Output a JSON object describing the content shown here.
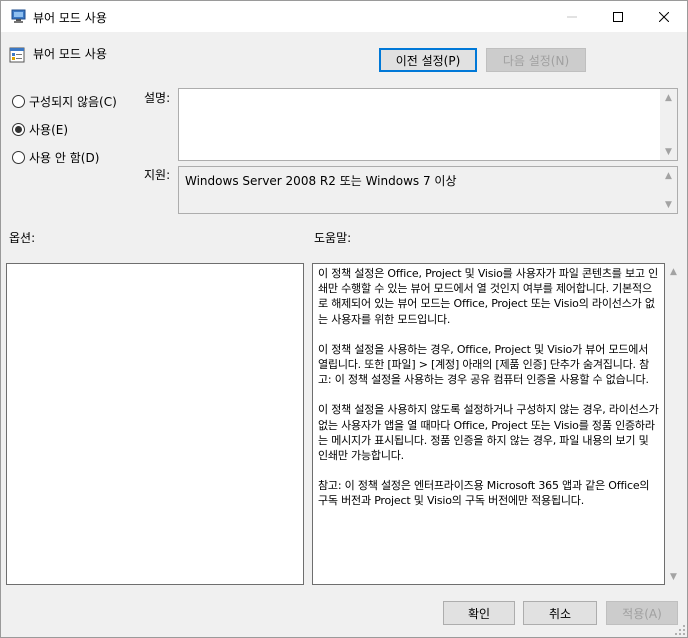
{
  "window": {
    "title": "뷰어 모드 사용",
    "icon": "policy-window-icon",
    "controls": {
      "minimize_icon": "minimize-icon",
      "maximize_icon": "maximize-icon",
      "close_icon": "close-icon"
    }
  },
  "header": {
    "title": "뷰어 모드 사용",
    "icon": "policy-setting-icon",
    "prev_label": "이전 설정(P)",
    "next_label": "다음 설정(N)"
  },
  "state": {
    "options": [
      {
        "label": "구성되지 않음(C)",
        "selected": false
      },
      {
        "label": "사용(E)",
        "selected": true
      },
      {
        "label": "사용 안 함(D)",
        "selected": false
      }
    ]
  },
  "description": {
    "label": "설명:",
    "value": ""
  },
  "supported": {
    "label": "지원:",
    "value": "Windows Server 2008 R2 또는 Windows 7 이상"
  },
  "options_panel": {
    "label": "옵션:"
  },
  "help_panel": {
    "label": "도움말:",
    "paragraphs": [
      "이 정책 설정은 Office, Project 및 Visio를 사용자가 파일 콘텐츠를 보고 인쇄만 수행할 수 있는 뷰어 모드에서 열 것인지 여부를 제어합니다. 기본적으로 해제되어 있는 뷰어 모드는 Office, Project 또는 Visio의 라이선스가 없는 사용자를 위한 모드입니다.",
      "이 정책 설정을 사용하는 경우, Office, Project 및 Visio가 뷰어 모드에서 열립니다. 또한 [파일] > [계정] 아래의 [제품 인증] 단추가 숨겨집니다. 참고: 이 정책 설정을 사용하는 경우 공유 컴퓨터 인증을 사용할 수 없습니다.",
      "이 정책 설정을 사용하지 않도록 설정하거나 구성하지 않는 경우, 라이선스가 없는 사용자가 앱을 열 때마다 Office, Project 또는 Visio를 정품 인증하라는 메시지가 표시됩니다. 정품 인증을 하지 않는 경우, 파일 내용의 보기 및 인쇄만 가능합니다.",
      "참고: 이 정책 설정은 엔터프라이즈용 Microsoft 365 앱과 같은 Office의 구독 버전과 Project 및 Visio의 구독 버전에만 적용됩니다."
    ]
  },
  "footer": {
    "ok_label": "확인",
    "cancel_label": "취소",
    "apply_label": "적용(A)"
  },
  "colors": {
    "default_button_border": "#0078d7",
    "window_bg": "#f0f0f0"
  }
}
